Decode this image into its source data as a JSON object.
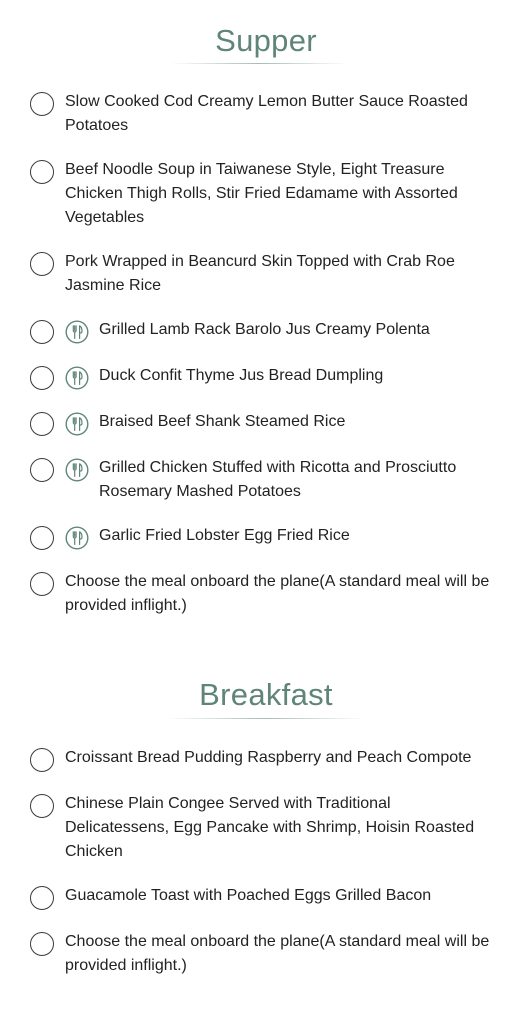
{
  "supper": {
    "title": "Supper",
    "options": [
      {
        "label": "Slow Cooked Cod Creamy Lemon Butter Sauce Roasted Potatoes",
        "icon": null
      },
      {
        "label": "Beef Noodle Soup in Taiwanese Style, Eight Treasure Chicken Thigh Rolls, Stir Fried Edamame with Assorted Vegetables",
        "icon": null
      },
      {
        "label": "Pork Wrapped in Beancurd Skin Topped with Crab Roe Jasmine Rice",
        "icon": null
      },
      {
        "label": "Grilled Lamb Rack Barolo Jus Creamy Polenta",
        "icon": "fork-knife-icon"
      },
      {
        "label": "Duck Confit Thyme Jus Bread Dumpling",
        "icon": "fork-knife-icon"
      },
      {
        "label": "Braised Beef Shank Steamed Rice",
        "icon": "fork-knife-icon"
      },
      {
        "label": "Grilled Chicken Stuffed with Ricotta and Prosciutto Rosemary Mashed Potatoes",
        "icon": "fork-knife-icon"
      },
      {
        "label": "Garlic Fried Lobster Egg Fried Rice",
        "icon": "fork-knife-icon"
      },
      {
        "label": "Choose the meal onboard the plane(A standard meal will be provided inflight.)",
        "icon": null
      }
    ]
  },
  "breakfast": {
    "title": "Breakfast",
    "options": [
      {
        "label": "Croissant Bread Pudding Raspberry and Peach Compote",
        "icon": null
      },
      {
        "label": "Chinese Plain Congee Served with Traditional Delicatessens, Egg Pancake with Shrimp, Hoisin Roasted Chicken",
        "icon": null
      },
      {
        "label": "Guacamole Toast with Poached Eggs Grilled Bacon",
        "icon": null
      },
      {
        "label": "Choose the meal onboard the plane(A standard meal will be provided inflight.)",
        "icon": null
      }
    ]
  },
  "colors": {
    "accent": "#5f8577",
    "text": "#222222",
    "radio_border": "#3a3a3a"
  }
}
